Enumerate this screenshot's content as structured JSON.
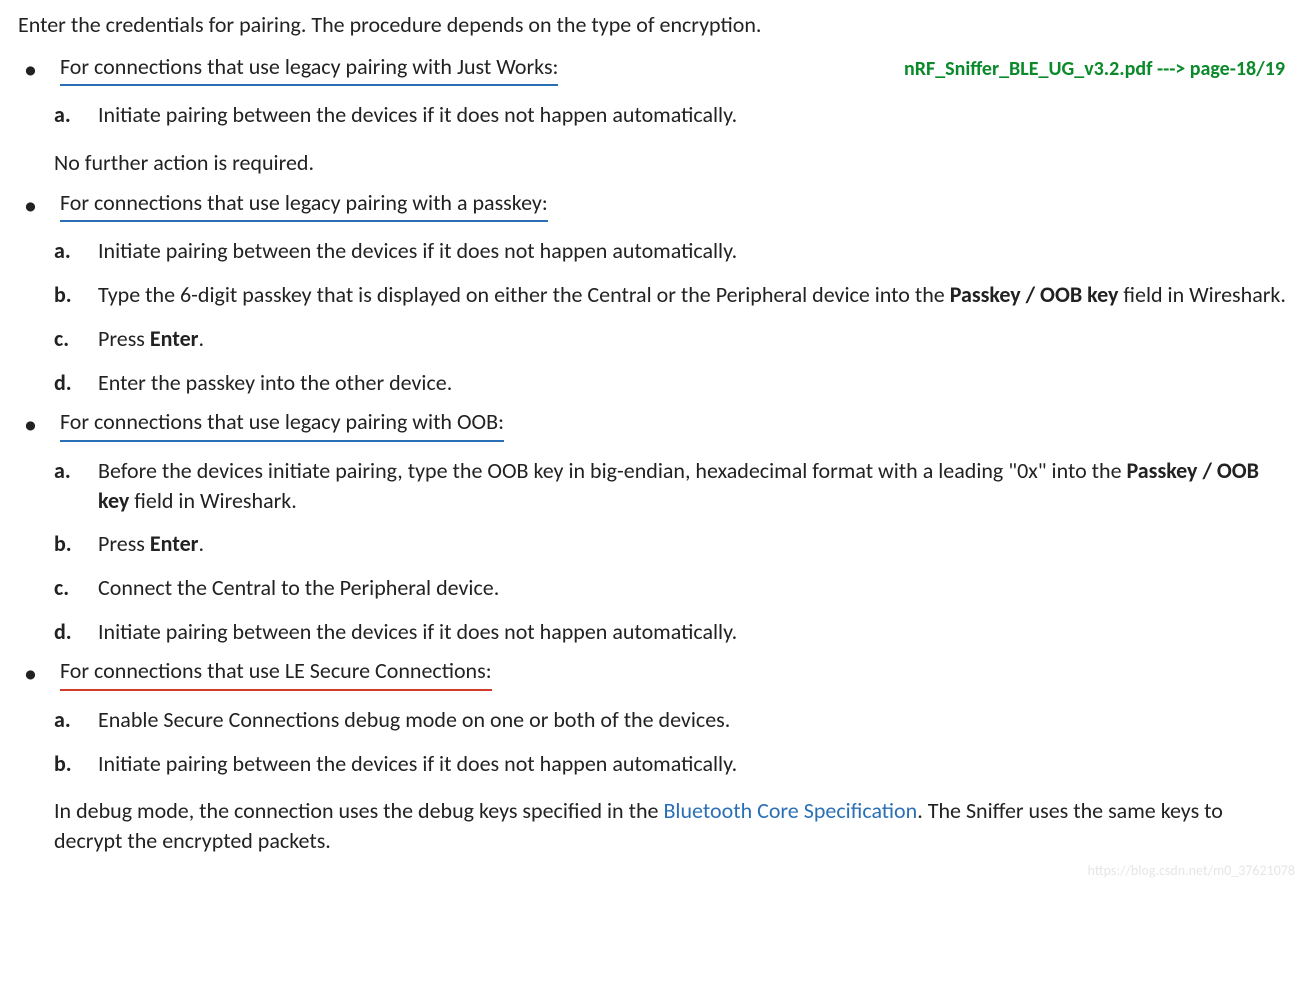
{
  "intro": "Enter the credentials for pairing. The procedure depends on the type of encryption.",
  "annotation": "nRF_Sniffer_BLE_UG_v3.2.pdf ---> page-18/19",
  "sections": [
    {
      "heading": "For connections that use legacy pairing with Just Works:",
      "underline": "blue",
      "steps": [
        {
          "label": "a.",
          "plain": "Initiate pairing between the devices if it does not happen automatically."
        }
      ],
      "tail_plain": "No further action is required."
    },
    {
      "heading": "For connections that use legacy pairing with a passkey:",
      "underline": "blue",
      "steps": [
        {
          "label": "a.",
          "plain": "Initiate pairing between the devices if it does not happen automatically."
        },
        {
          "label": "b.",
          "pre": "Type the 6-digit passkey that is displayed on either the Central or the Peripheral device into the ",
          "bold": "Passkey / OOB key",
          "post": " field in Wireshark."
        },
        {
          "label": "c.",
          "pre": "Press ",
          "bold": "Enter",
          "post": "."
        },
        {
          "label": "d.",
          "plain": "Enter the passkey into the other device."
        }
      ]
    },
    {
      "heading": "For connections that use legacy pairing with OOB:",
      "underline": "blue",
      "steps": [
        {
          "label": "a.",
          "pre": "Before the devices initiate pairing, type the OOB key in big-endian, hexadecimal format with a leading \"0x\" into the ",
          "bold": "Passkey / OOB key",
          "post": " field in Wireshark."
        },
        {
          "label": "b.",
          "pre": "Press ",
          "bold": "Enter",
          "post": "."
        },
        {
          "label": "c.",
          "plain": "Connect the Central to the Peripheral device."
        },
        {
          "label": "d.",
          "plain": "Initiate pairing between the devices if it does not happen automatically."
        }
      ]
    },
    {
      "heading": "For connections that use LE Secure Connections:",
      "underline": "red",
      "steps": [
        {
          "label": "a.",
          "plain": "Enable Secure Connections debug mode on one or both of the devices."
        },
        {
          "label": "b.",
          "plain": "Initiate pairing between the devices if it does not happen automatically."
        }
      ],
      "tail_rich": {
        "pre": "In debug mode, the connection uses the debug keys specified in the ",
        "link": "Bluetooth Core Specification",
        "post": ". The Sniffer uses the same keys to decrypt the encrypted packets."
      }
    }
  ],
  "watermark": "https://blog.csdn.net/m0_37621078"
}
